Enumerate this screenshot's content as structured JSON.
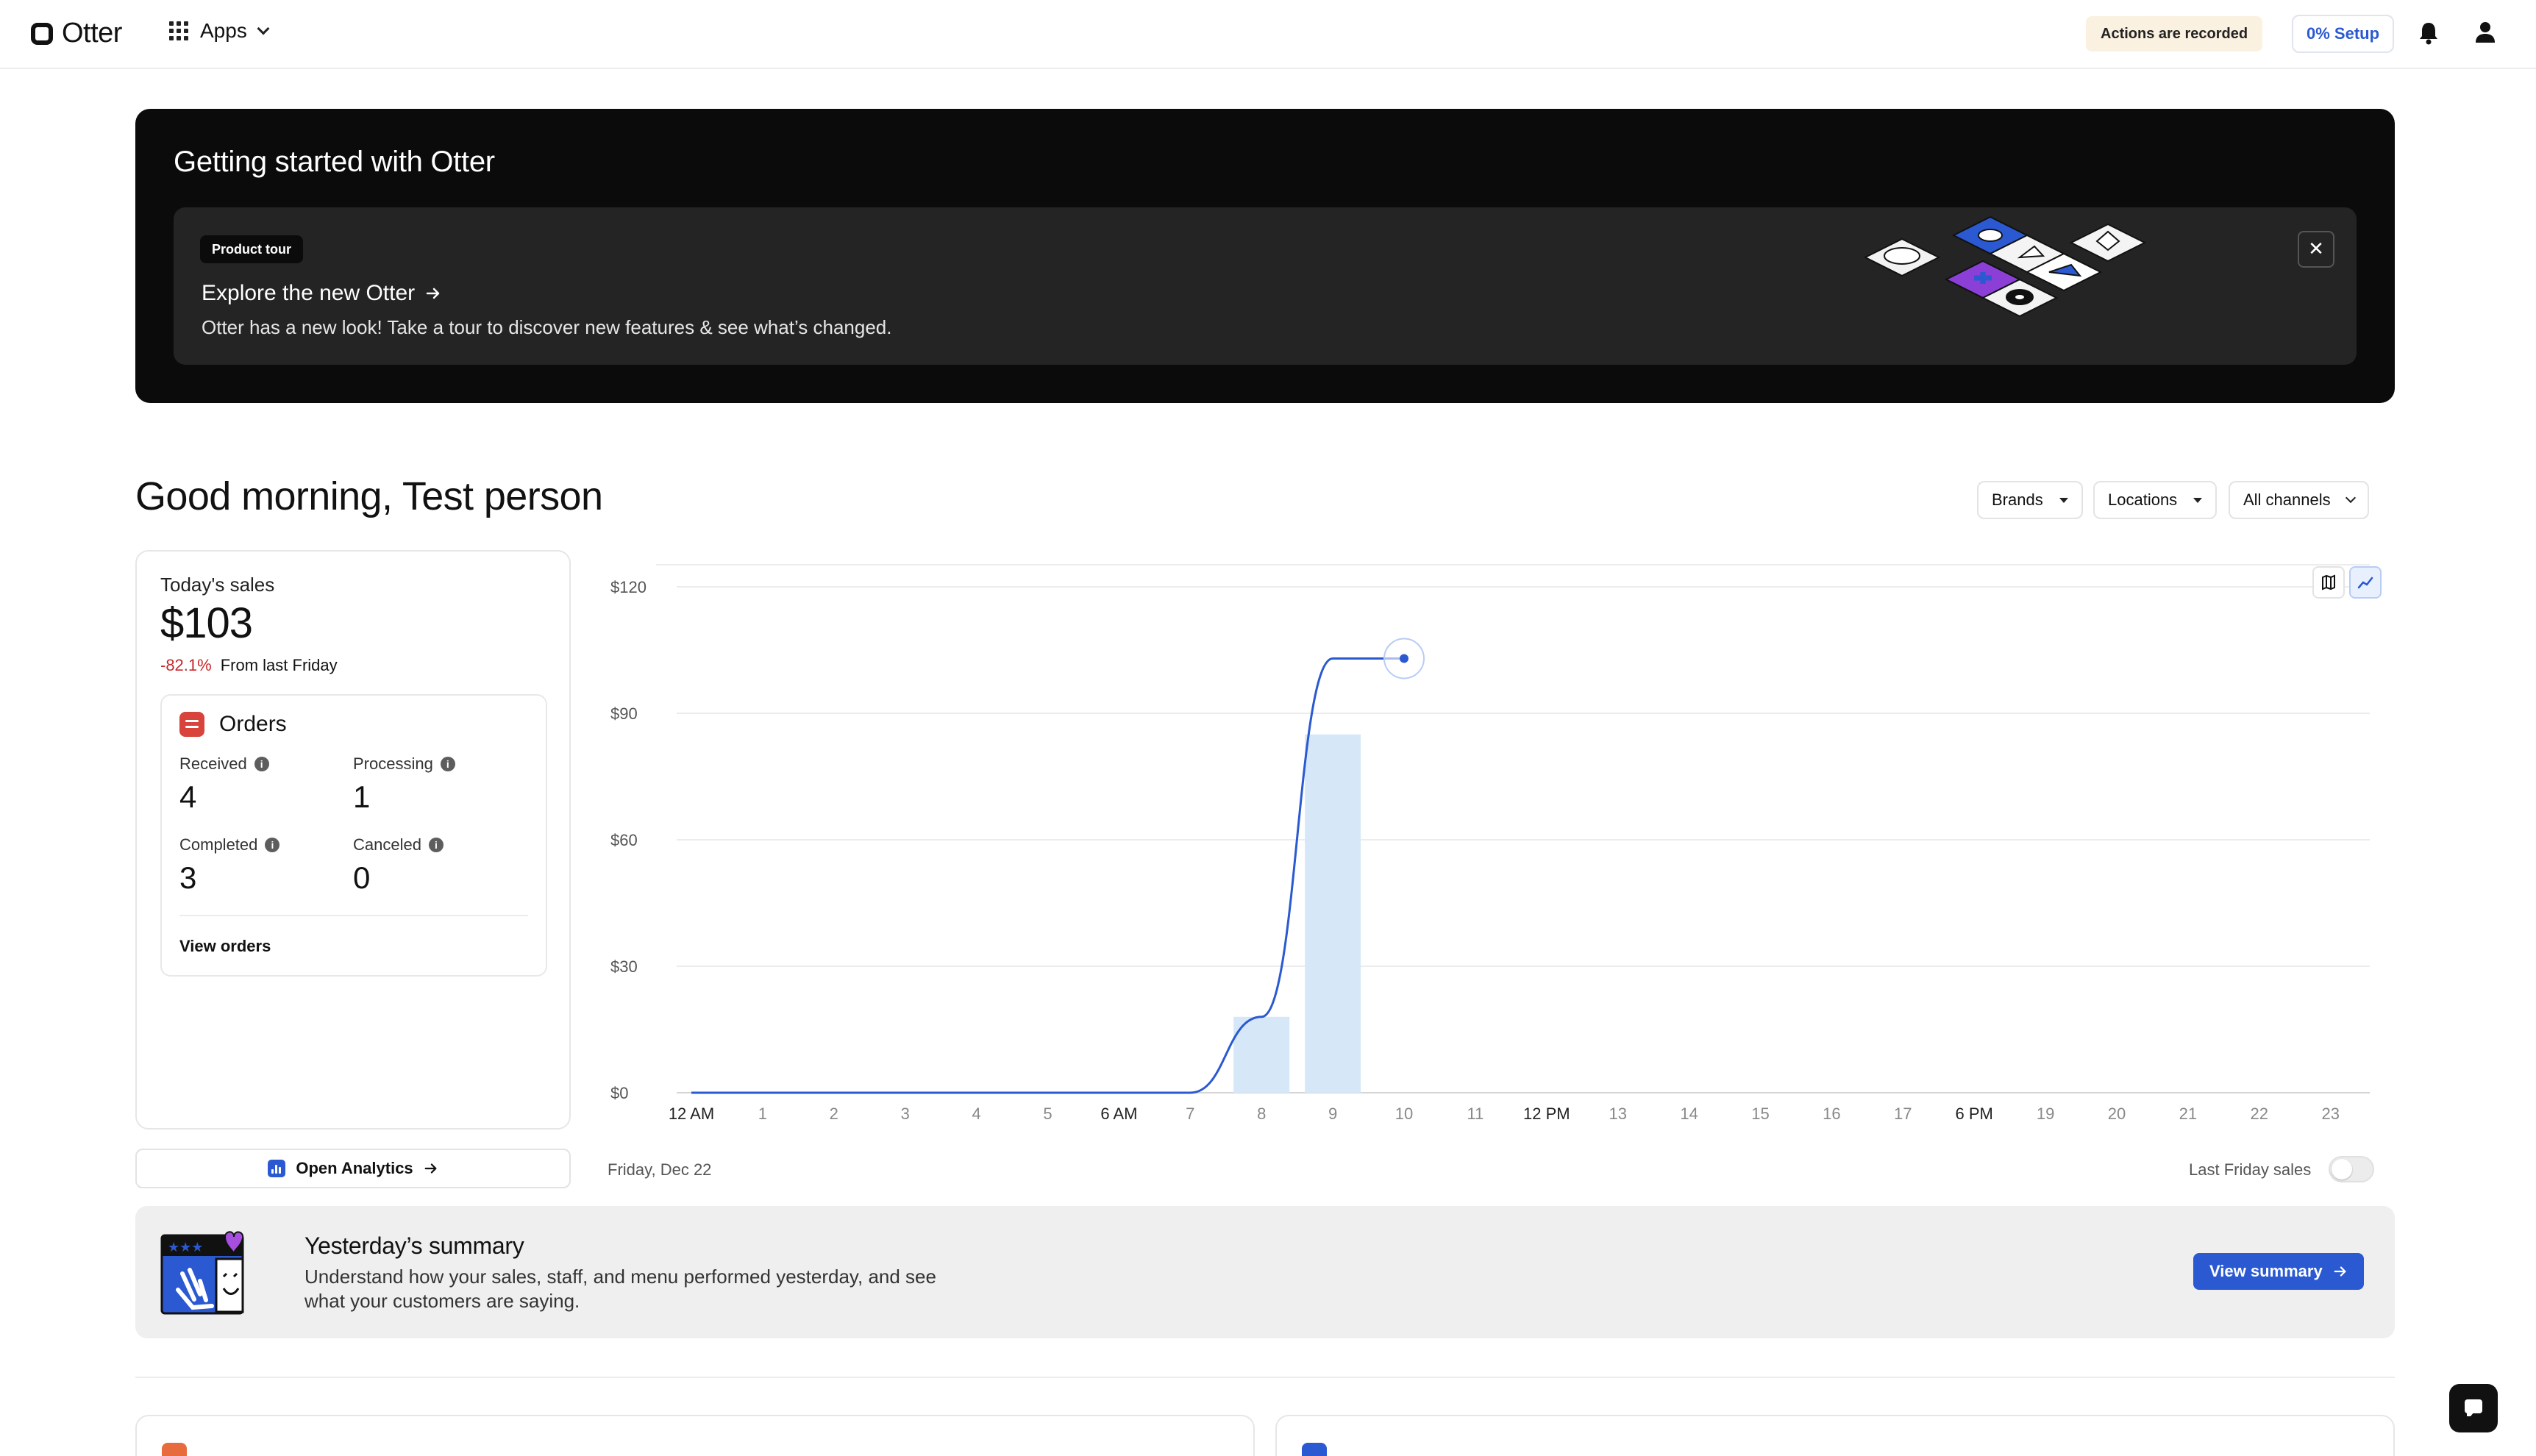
{
  "header": {
    "logo_text": "Otter",
    "apps_label": "Apps",
    "recorded_badge": "Actions are recorded",
    "setup_label": "0% Setup",
    "icons": [
      "grid-icon",
      "chevron-down-icon",
      "bell-icon",
      "user-icon"
    ]
  },
  "banner": {
    "title": "Getting started with Otter",
    "chip": "Product tour",
    "tour_title": "Explore the new Otter",
    "tour_desc": "Otter has a new look! Take a tour to discover new features & see what’s changed.",
    "close_label": "✕"
  },
  "greeting": "Good morning, Test person",
  "filters": {
    "brands": "Brands",
    "locations": "Locations",
    "channels": "All channels"
  },
  "sales": {
    "label": "Today's sales",
    "value": "$103",
    "change": "-82.1%",
    "change_suffix": "From last Friday",
    "orders": {
      "title": "Orders",
      "received_label": "Received",
      "received": "4",
      "processing_label": "Processing",
      "processing": "1",
      "completed_label": "Completed",
      "completed": "3",
      "canceled_label": "Canceled",
      "canceled": "0",
      "view_orders": "View orders"
    },
    "analytics_btn": "Open Analytics"
  },
  "chart_data": {
    "type": "bar+line",
    "x_tick_labels": [
      "12 AM",
      "1",
      "2",
      "3",
      "4",
      "5",
      "6 AM",
      "7",
      "8",
      "9",
      "10",
      "11",
      "12 PM",
      "13",
      "14",
      "15",
      "16",
      "17",
      "6 PM",
      "19",
      "20",
      "21",
      "22",
      "23"
    ],
    "y_tick_labels": [
      "$0",
      "$30",
      "$60",
      "$90",
      "$120"
    ],
    "ylim": [
      0,
      120
    ],
    "hourly_bars": {
      "hours": [
        8,
        9
      ],
      "values": [
        18,
        85
      ]
    },
    "cumulative_line": {
      "hours": [
        0,
        1,
        2,
        3,
        4,
        5,
        6,
        7,
        8,
        9,
        10
      ],
      "values": [
        0,
        0,
        0,
        0,
        0,
        0,
        0,
        0,
        18,
        103,
        103
      ]
    },
    "grid": true,
    "colors": {
      "bar": "#d6e8f8",
      "line": "#2a59d1",
      "grid": "#ececec"
    }
  },
  "chart_footer": {
    "date": "Friday, Dec 22",
    "last_friday": "Last Friday sales"
  },
  "summary": {
    "title": "Yesterday’s summary",
    "desc": "Understand how your sales, staff, and menu performed yesterday, and see what your customers are saying.",
    "button": "View summary"
  }
}
